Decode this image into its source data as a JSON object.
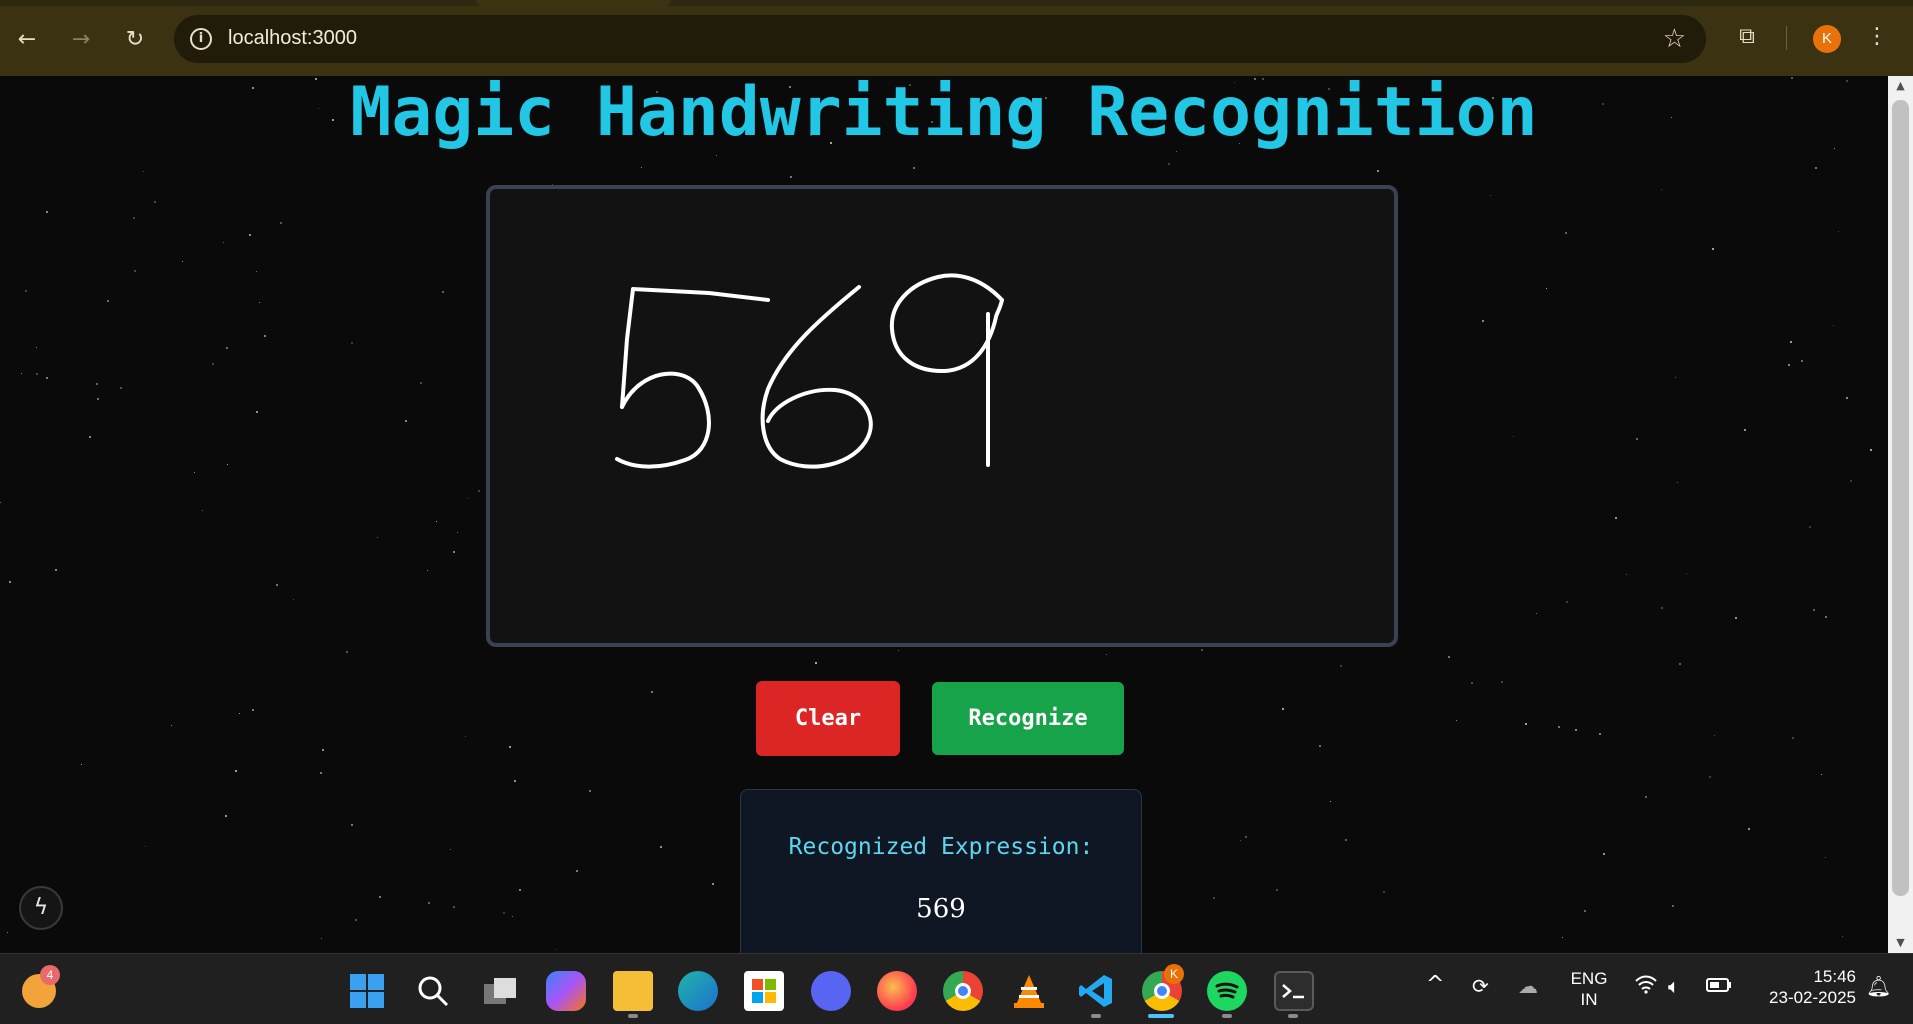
{
  "browser": {
    "url": "localhost:3000",
    "profile_initial": "K",
    "icons": {
      "back": "←",
      "forward": "→",
      "reload": "↻",
      "info": "i",
      "star": "☆",
      "extensions": "⧉",
      "menu": "⋮"
    }
  },
  "page": {
    "title": "Magic Handwriting Recognition",
    "drawn_digits": "569",
    "buttons": {
      "clear": "Clear",
      "recognize": "Recognize"
    },
    "result": {
      "label": "Recognized Expression:",
      "value": "569"
    },
    "bolt_icon": "ϟ",
    "colors": {
      "title": "#22c7e6",
      "clear": "#dc2626",
      "recognize": "#16a34a",
      "result_label": "#5ed6ee"
    }
  },
  "scrollbar": {
    "up": "▲",
    "down": "▼"
  },
  "taskbar": {
    "notification_count": "4",
    "chrome_badge": "K",
    "apps": [
      "start-icon",
      "search-icon",
      "task-view-icon",
      "copilot-icon",
      "file-explorer-icon",
      "edge-icon",
      "store-icon",
      "discord-icon",
      "firefox-icon",
      "chrome-icon",
      "vlc-icon",
      "vscode-icon",
      "chrome-profile-icon",
      "spotify-icon",
      "terminal-icon"
    ],
    "tray": {
      "chevron": "^",
      "language": "ENG",
      "region": "IN",
      "time": "15:46",
      "date": "23-02-2025"
    }
  }
}
